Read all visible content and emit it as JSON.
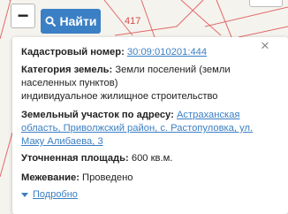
{
  "map": {
    "parcel_number_label": "417",
    "colors": {
      "parcel_border": "#d94a4a",
      "background": "#f5f3ee"
    }
  },
  "toolbar": {
    "zoom_out_label": "−",
    "find_label": "Найти",
    "find_icon": "search-icon",
    "accent_color": "#3b7fc4"
  },
  "card": {
    "close_label": "×",
    "cadastral": {
      "label": "Кадастровый номер:",
      "value": "30:09:010201:444"
    },
    "category": {
      "label": "Категория земель:",
      "value": "Земли поселений (земли населенных пунктов)",
      "usage": "индивидуальное жилищное строительство"
    },
    "address": {
      "label": "Земельный участок по адресу:",
      "value": "Астраханская область, Приволжский район, с. Растопуловка, ул. Маку Алибаева, 3"
    },
    "area": {
      "label": "Уточненная площадь:",
      "value": "600 кв.м."
    },
    "survey": {
      "label": "Межевание:",
      "value": "Проведено"
    },
    "more_label": "Подробно"
  }
}
